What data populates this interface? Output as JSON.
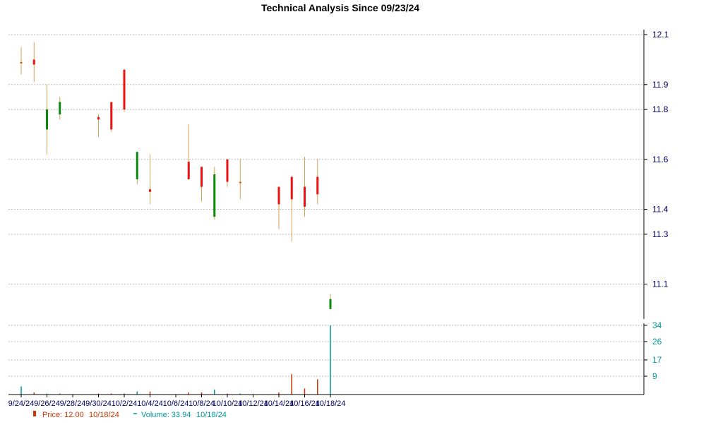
{
  "chart_data": {
    "type": "candlestick",
    "title": "Technical Analysis Since 09/23/24",
    "colors": {
      "up": "#0a8a0a",
      "down": "#ee1111",
      "doji": "#cc6600",
      "volume_down": "#cc3300",
      "volume_up": "#009999",
      "wick": "#d4a055",
      "grid": "#bbbbbb",
      "axis_text": "#000066"
    },
    "price_axis": {
      "ticks": [
        "12.1",
        "11.9",
        "11.8",
        "11.6",
        "11.4",
        "11.3",
        "11.1"
      ],
      "range": [
        10.96,
        12.12
      ]
    },
    "volume_axis": {
      "ticks": [
        34,
        26,
        17,
        9
      ],
      "range": [
        0,
        35
      ]
    },
    "x_labels": [
      "9/24/24",
      "9/26/24",
      "9/28/24",
      "9/30/24",
      "10/2/24",
      "10/4/24",
      "10/6/24",
      "10/8/24",
      "10/10/24",
      "10/12/24",
      "10/14/24",
      "10/16/24",
      "10/18/24"
    ],
    "candles": [
      {
        "date": "9/24/24",
        "open": 11.99,
        "high": 12.05,
        "low": 11.94,
        "close": 11.99,
        "volume": 4
      },
      {
        "date": "9/25/24",
        "open": 12.0,
        "high": 12.07,
        "low": 11.91,
        "close": 11.98,
        "volume": 1
      },
      {
        "date": "9/26/24",
        "open": 11.72,
        "high": 11.9,
        "low": 11.62,
        "close": 11.8,
        "volume": 0.5
      },
      {
        "date": "9/27/24",
        "open": 11.78,
        "high": 11.85,
        "low": 11.76,
        "close": 11.83,
        "volume": 0.5
      },
      {
        "date": "9/30/24",
        "open": 11.77,
        "high": 11.78,
        "low": 11.69,
        "close": 11.76,
        "volume": 0.5
      },
      {
        "date": "10/1/24",
        "open": 11.83,
        "high": 11.83,
        "low": 11.71,
        "close": 11.72,
        "volume": 0.5
      },
      {
        "date": "10/2/24",
        "open": 11.96,
        "high": 11.96,
        "low": 11.79,
        "close": 11.8,
        "volume": 0.5
      },
      {
        "date": "10/3/24",
        "open": 11.52,
        "high": 11.63,
        "low": 11.5,
        "close": 11.63,
        "volume": 1.5
      },
      {
        "date": "10/4/24",
        "open": 11.48,
        "high": 11.62,
        "low": 11.42,
        "close": 11.47,
        "volume": 1.5
      },
      {
        "date": "10/7/24",
        "open": 11.59,
        "high": 11.74,
        "low": 11.53,
        "close": 11.52,
        "volume": 1
      },
      {
        "date": "10/8/24",
        "open": 11.57,
        "high": 11.57,
        "low": 11.43,
        "close": 11.49,
        "volume": 1
      },
      {
        "date": "10/9/24",
        "open": 11.37,
        "high": 11.57,
        "low": 11.36,
        "close": 11.54,
        "volume": 2.5
      },
      {
        "date": "10/10/24",
        "open": 11.6,
        "high": 11.6,
        "low": 11.49,
        "close": 11.51,
        "volume": 0.5
      },
      {
        "date": "10/11/24",
        "open": 11.51,
        "high": 11.6,
        "low": 11.44,
        "close": 11.51,
        "volume": 0.5
      },
      {
        "date": "10/14/24",
        "open": 11.49,
        "high": 11.49,
        "low": 11.32,
        "close": 11.42,
        "volume": 1
      },
      {
        "date": "10/15/24",
        "open": 11.53,
        "high": 11.53,
        "low": 11.27,
        "close": 11.44,
        "volume": 10
      },
      {
        "date": "10/16/24",
        "open": 11.49,
        "high": 11.61,
        "low": 11.37,
        "close": 11.41,
        "volume": 3
      },
      {
        "date": "10/17/24",
        "open": 11.53,
        "high": 11.6,
        "low": 11.42,
        "close": 11.46,
        "volume": 7.5
      },
      {
        "date": "10/18/24",
        "open": 11.0,
        "high": 11.06,
        "low": 11.0,
        "close": 11.04,
        "volume": 33.94
      }
    ],
    "legend": {
      "price_label": "Price: 12.00",
      "price_date": "10/18/24",
      "volume_label": "Volume: 33.94",
      "volume_date": "10/18/24"
    }
  }
}
